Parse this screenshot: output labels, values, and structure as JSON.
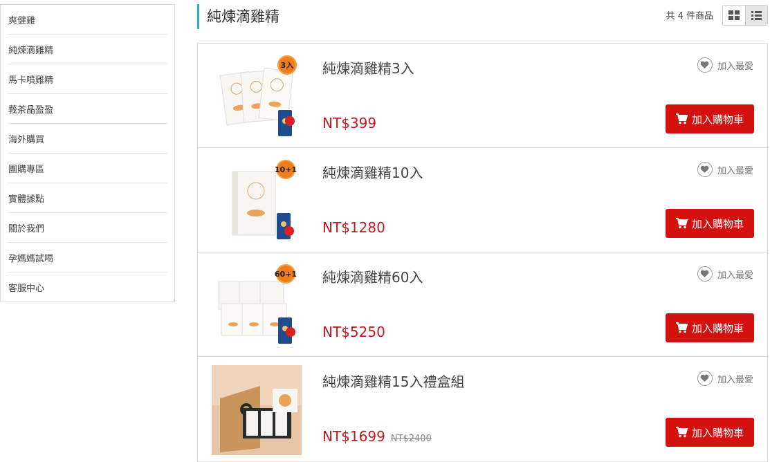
{
  "sidebar": {
    "items": [
      {
        "label": "爽健雞"
      },
      {
        "label": "純煉滴雞精"
      },
      {
        "label": "馬卡噴雞精"
      },
      {
        "label": "莪茶晶盈盈"
      },
      {
        "label": "海外購買"
      },
      {
        "label": "團購專區"
      },
      {
        "label": "實體據點"
      },
      {
        "label": "關於我們"
      },
      {
        "label": "孕媽媽試喝"
      },
      {
        "label": "客服中心"
      }
    ]
  },
  "header": {
    "title": "純煉滴雞精",
    "count": "共 4 件商品"
  },
  "colors": {
    "accent": "#2bb3c0",
    "price": "#c8161d",
    "cart_button": "#d3110f",
    "badge": "#ef7d1a"
  },
  "products": [
    {
      "name": "純煉滴雞精3入",
      "price": "NT$399",
      "old_price": "",
      "badge": "3入",
      "fav_label": "加入最愛",
      "cart_label": "加入購物車"
    },
    {
      "name": "純煉滴雞精10入",
      "price": "NT$1280",
      "old_price": "",
      "badge": "10+1",
      "fav_label": "加入最愛",
      "cart_label": "加入購物車"
    },
    {
      "name": "純煉滴雞精60入",
      "price": "NT$5250",
      "old_price": "",
      "badge": "60+1",
      "fav_label": "加入最愛",
      "cart_label": "加入購物車"
    },
    {
      "name": "純煉滴雞精15入禮盒組",
      "price": "NT$1699",
      "old_price": "NT$2400",
      "badge": "",
      "fav_label": "加入最愛",
      "cart_label": "加入購物車"
    }
  ]
}
